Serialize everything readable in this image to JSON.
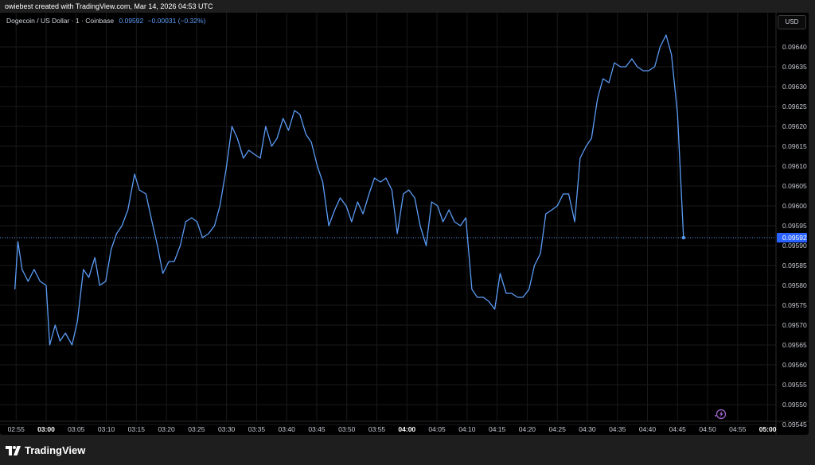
{
  "header": {
    "caption": "owiebest created with TradingView.com, Mar 14, 2026 04:53 UTC"
  },
  "legend": {
    "symbol": "Dogecoin / US Dollar · 1 · Coinbase",
    "price": "0.09592",
    "change": "−0.00031 (−0.32%)"
  },
  "currency_button": "USD",
  "brand": {
    "name": "TradingView"
  },
  "colors": {
    "series": "#5b9cf6",
    "price_label_bg": "#2962ff",
    "background": "#000000",
    "grid": "#1a1a1a"
  },
  "icons": [
    "tradingview-logo-icon",
    "lightning-icon"
  ],
  "chart_data": {
    "type": "line",
    "title": "Dogecoin / US Dollar · 1 · Coinbase",
    "series_name": "",
    "ylim": [
      0.09545,
      0.09642
    ],
    "y_ticks": [
      "0.09545",
      "0.09550",
      "0.09555",
      "0.09560",
      "0.09565",
      "0.09570",
      "0.09575",
      "0.09580",
      "0.09585",
      "0.09590",
      "0.09595",
      "0.09600",
      "0.09605",
      "0.09610",
      "0.09615",
      "0.09620",
      "0.09625",
      "0.09630",
      "0.09635",
      "0.09640"
    ],
    "x_ticks": [
      {
        "label": "02:55",
        "minute": -5,
        "bold": false
      },
      {
        "label": "03:00",
        "minute": 0,
        "bold": true
      },
      {
        "label": "03:05",
        "minute": 5,
        "bold": false
      },
      {
        "label": "03:10",
        "minute": 10,
        "bold": false
      },
      {
        "label": "03:15",
        "minute": 15,
        "bold": false
      },
      {
        "label": "03:20",
        "minute": 20,
        "bold": false
      },
      {
        "label": "03:25",
        "minute": 25,
        "bold": false
      },
      {
        "label": "03:30",
        "minute": 30,
        "bold": false
      },
      {
        "label": "03:35",
        "minute": 35,
        "bold": false
      },
      {
        "label": "03:40",
        "minute": 40,
        "bold": false
      },
      {
        "label": "03:45",
        "minute": 45,
        "bold": false
      },
      {
        "label": "03:50",
        "minute": 50,
        "bold": false
      },
      {
        "label": "03:55",
        "minute": 55,
        "bold": false
      },
      {
        "label": "04:00",
        "minute": 60,
        "bold": true
      },
      {
        "label": "04:05",
        "minute": 65,
        "bold": false
      },
      {
        "label": "04:10",
        "minute": 70,
        "bold": false
      },
      {
        "label": "04:15",
        "minute": 75,
        "bold": false
      },
      {
        "label": "04:20",
        "minute": 80,
        "bold": false
      },
      {
        "label": "04:25",
        "minute": 85,
        "bold": false
      },
      {
        "label": "04:30",
        "minute": 90,
        "bold": false
      },
      {
        "label": "04:35",
        "minute": 95,
        "bold": false
      },
      {
        "label": "04:40",
        "minute": 100,
        "bold": false
      },
      {
        "label": "04:45",
        "minute": 105,
        "bold": false
      },
      {
        "label": "04:50",
        "minute": 110,
        "bold": false
      },
      {
        "label": "04:55",
        "minute": 115,
        "bold": false
      },
      {
        "label": "05:00",
        "minute": 120,
        "bold": true
      }
    ],
    "x_minute_range": [
      -5.4,
      120.6
    ],
    "last_price": "0.09592",
    "points": [
      [
        -5.2,
        0.09579
      ],
      [
        -4.7,
        0.09591
      ],
      [
        -4.0,
        0.09584
      ],
      [
        -3.0,
        0.09581
      ],
      [
        -2.0,
        0.09584
      ],
      [
        -1.0,
        0.09581
      ],
      [
        0.0,
        0.0958
      ],
      [
        0.6,
        0.09565
      ],
      [
        1.5,
        0.0957
      ],
      [
        2.3,
        0.09566
      ],
      [
        3.2,
        0.09568
      ],
      [
        4.3,
        0.09565
      ],
      [
        5.2,
        0.09571
      ],
      [
        6.2,
        0.09584
      ],
      [
        7.1,
        0.09582
      ],
      [
        8.1,
        0.09587
      ],
      [
        8.9,
        0.0958
      ],
      [
        9.9,
        0.09581
      ],
      [
        10.8,
        0.09589
      ],
      [
        11.7,
        0.09593
      ],
      [
        12.6,
        0.09595
      ],
      [
        13.6,
        0.09599
      ],
      [
        14.7,
        0.09608
      ],
      [
        15.5,
        0.09604
      ],
      [
        16.6,
        0.09603
      ],
      [
        17.6,
        0.09596
      ],
      [
        18.5,
        0.0959
      ],
      [
        19.4,
        0.09583
      ],
      [
        20.4,
        0.09586
      ],
      [
        21.3,
        0.09586
      ],
      [
        22.3,
        0.0959
      ],
      [
        23.2,
        0.09596
      ],
      [
        24.2,
        0.09597
      ],
      [
        25.1,
        0.09596
      ],
      [
        26.0,
        0.09592
      ],
      [
        27.0,
        0.09593
      ],
      [
        28.0,
        0.09595
      ],
      [
        28.9,
        0.096
      ],
      [
        29.9,
        0.09609
      ],
      [
        30.9,
        0.0962
      ],
      [
        31.8,
        0.09617
      ],
      [
        32.8,
        0.09612
      ],
      [
        33.7,
        0.09614
      ],
      [
        34.6,
        0.09613
      ],
      [
        35.6,
        0.09612
      ],
      [
        36.5,
        0.0962
      ],
      [
        37.5,
        0.09615
      ],
      [
        38.4,
        0.09617
      ],
      [
        39.4,
        0.09622
      ],
      [
        40.3,
        0.09619
      ],
      [
        41.3,
        0.09624
      ],
      [
        42.2,
        0.09623
      ],
      [
        43.2,
        0.09618
      ],
      [
        44.1,
        0.09616
      ],
      [
        45.1,
        0.0961
      ],
      [
        46.0,
        0.09606
      ],
      [
        47.0,
        0.09595
      ],
      [
        48.0,
        0.09599
      ],
      [
        48.9,
        0.09602
      ],
      [
        49.9,
        0.096
      ],
      [
        50.8,
        0.09596
      ],
      [
        51.8,
        0.09601
      ],
      [
        52.7,
        0.09598
      ],
      [
        53.7,
        0.09603
      ],
      [
        54.6,
        0.09607
      ],
      [
        55.6,
        0.09606
      ],
      [
        56.5,
        0.09607
      ],
      [
        57.5,
        0.09604
      ],
      [
        58.4,
        0.09593
      ],
      [
        59.4,
        0.09603
      ],
      [
        60.3,
        0.09604
      ],
      [
        61.3,
        0.09602
      ],
      [
        62.2,
        0.09595
      ],
      [
        63.2,
        0.0959
      ],
      [
        64.1,
        0.09601
      ],
      [
        65.1,
        0.096
      ],
      [
        66.0,
        0.09596
      ],
      [
        67.0,
        0.09599
      ],
      [
        67.9,
        0.09596
      ],
      [
        68.9,
        0.09595
      ],
      [
        69.8,
        0.09597
      ],
      [
        70.8,
        0.09579
      ],
      [
        71.7,
        0.09577
      ],
      [
        72.7,
        0.09577
      ],
      [
        73.6,
        0.09576
      ],
      [
        74.6,
        0.09574
      ],
      [
        75.5,
        0.09583
      ],
      [
        76.5,
        0.09578
      ],
      [
        77.4,
        0.09578
      ],
      [
        78.4,
        0.09577
      ],
      [
        79.3,
        0.09577
      ],
      [
        80.3,
        0.09579
      ],
      [
        81.2,
        0.09585
      ],
      [
        82.2,
        0.09588
      ],
      [
        83.1,
        0.09598
      ],
      [
        84.1,
        0.09599
      ],
      [
        85.0,
        0.096
      ],
      [
        86.0,
        0.09603
      ],
      [
        86.9,
        0.09603
      ],
      [
        87.9,
        0.09596
      ],
      [
        88.8,
        0.09612
      ],
      [
        89.8,
        0.09615
      ],
      [
        90.7,
        0.09617
      ],
      [
        91.7,
        0.09627
      ],
      [
        92.6,
        0.09632
      ],
      [
        93.6,
        0.09631
      ],
      [
        94.5,
        0.09636
      ],
      [
        95.5,
        0.09635
      ],
      [
        96.4,
        0.09635
      ],
      [
        97.4,
        0.09637
      ],
      [
        98.3,
        0.09635
      ],
      [
        99.3,
        0.09634
      ],
      [
        100.2,
        0.09634
      ],
      [
        101.2,
        0.09635
      ],
      [
        102.1,
        0.0964
      ],
      [
        103.1,
        0.09643
      ],
      [
        104.0,
        0.09638
      ],
      [
        105.0,
        0.09623
      ],
      [
        106.0,
        0.09592
      ]
    ]
  }
}
